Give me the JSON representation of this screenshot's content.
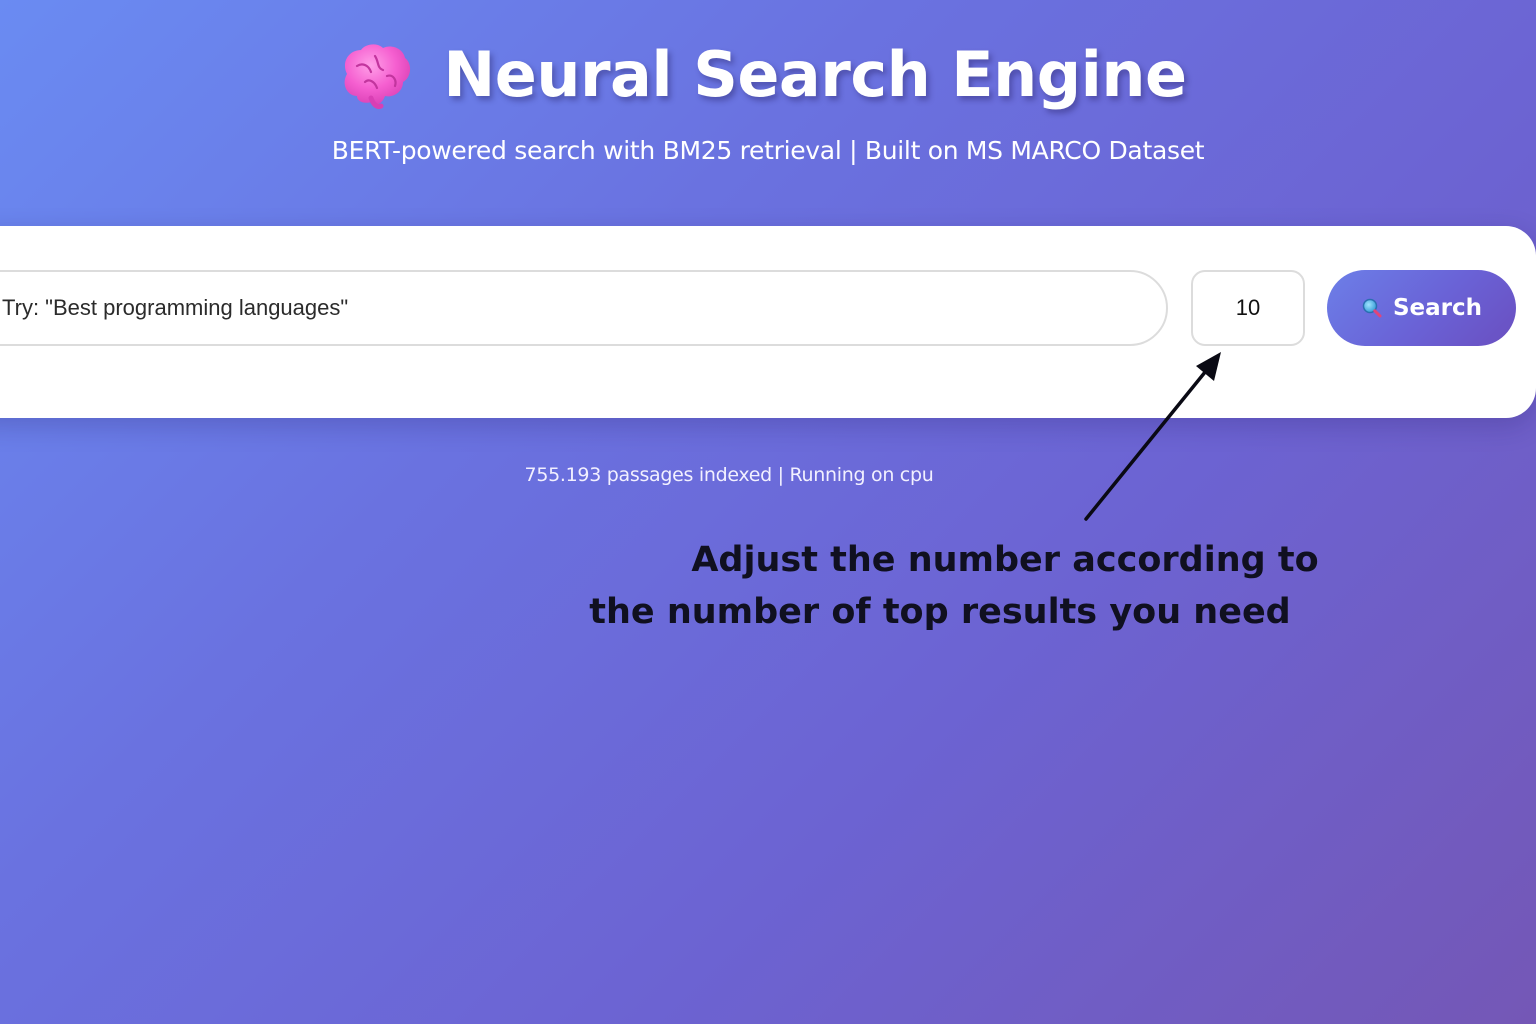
{
  "header": {
    "title": "Neural Search Engine",
    "subtitle": "BERT-powered search with BM25 retrieval | Built on MS MARCO Dataset",
    "icon": "brain-icon"
  },
  "search": {
    "placeholder": "Try: \"Best programming languages\"",
    "query_value": "",
    "top_k_value": "10",
    "button_label": "Search",
    "button_icon": "search-icon"
  },
  "status": {
    "text": "755.193 passages indexed | Running on cpu"
  },
  "annotation": {
    "line_1": "Adjust the number according to",
    "line_2": "the number of top results you need"
  },
  "colors": {
    "background_start": "#6a8bf2",
    "background_end": "#7457b6",
    "button_accent": "#6a62d6",
    "card": "#ffffff",
    "annotation_text": "#101020"
  }
}
